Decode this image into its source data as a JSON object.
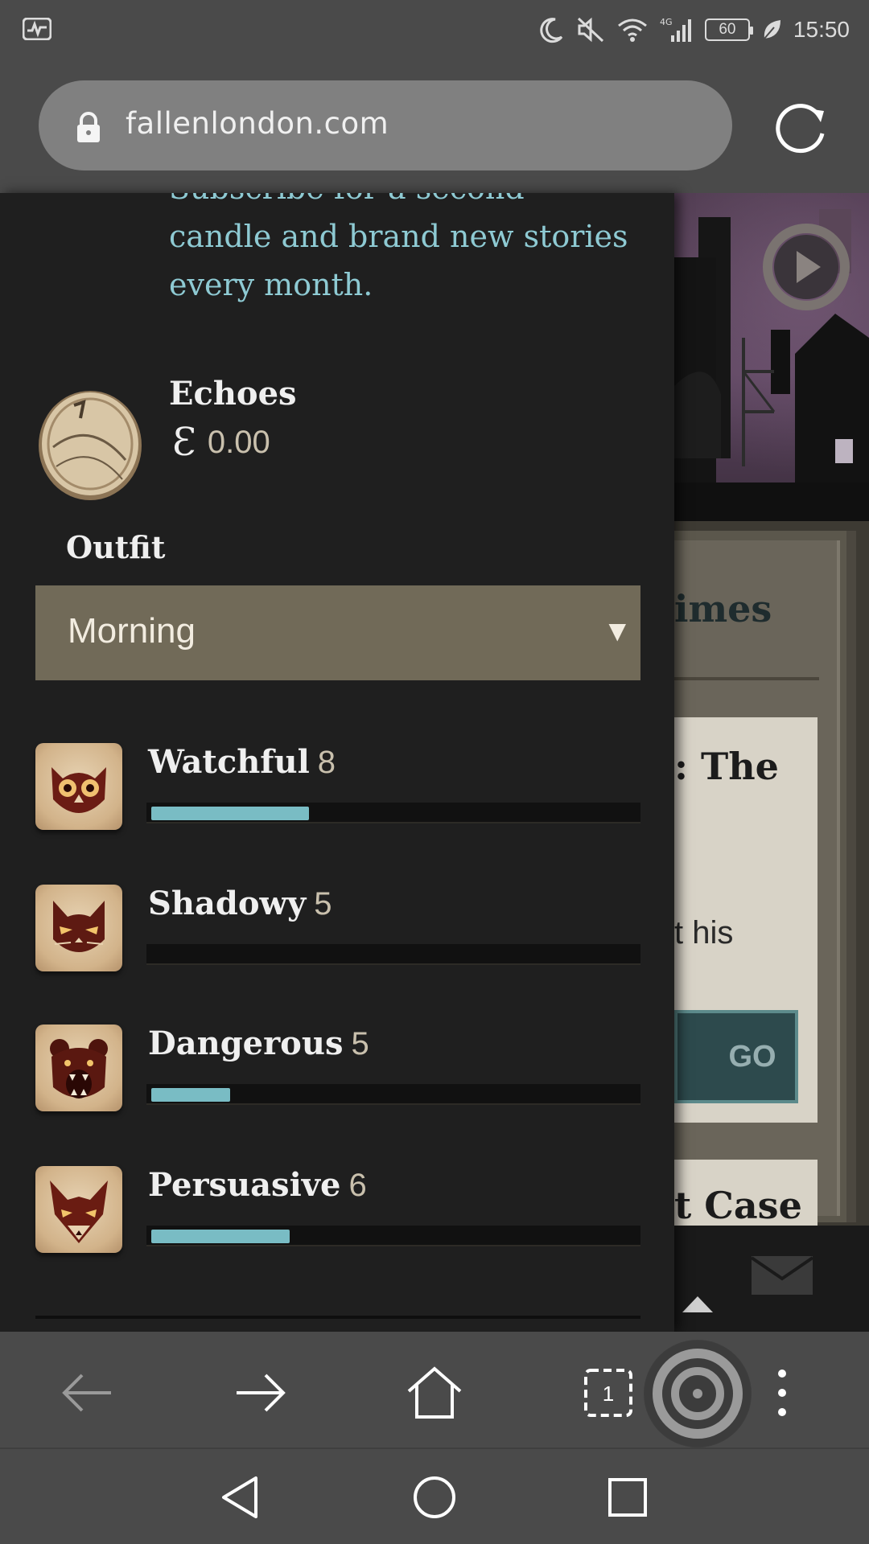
{
  "status_bar": {
    "time": "15:50",
    "battery": "60",
    "network": "4G"
  },
  "browser": {
    "url": "fallenlondon.com",
    "tab_count": "1"
  },
  "drawer": {
    "promo_lines": [
      "Subscribe for a second",
      "candle and brand new stories",
      "every month."
    ],
    "echoes": {
      "label": "Echoes",
      "symbol": "Ɛ",
      "value": "0.00"
    },
    "outfit": {
      "label": "Outfit",
      "selected": "Morning"
    },
    "stats": [
      {
        "name": "Watchful",
        "level": "8",
        "progress": 0.32,
        "icon": "owl-icon"
      },
      {
        "name": "Shadowy",
        "level": "5",
        "progress": 0.0,
        "icon": "cat-icon"
      },
      {
        "name": "Dangerous",
        "level": "5",
        "progress": 0.16,
        "icon": "bear-icon"
      },
      {
        "name": "Persuasive",
        "level": "6",
        "progress": 0.28,
        "icon": "fox-icon"
      }
    ]
  },
  "background_page": {
    "section_title_fragment": "imes",
    "card_title_fragment": ": The",
    "card_text_fragment": "t his",
    "go_label": "GO",
    "card2_title_fragment": "t Case"
  },
  "colors": {
    "accent_teal": "#79bcc4",
    "promo_text": "#8ecad3",
    "select_bg": "#716a58"
  }
}
